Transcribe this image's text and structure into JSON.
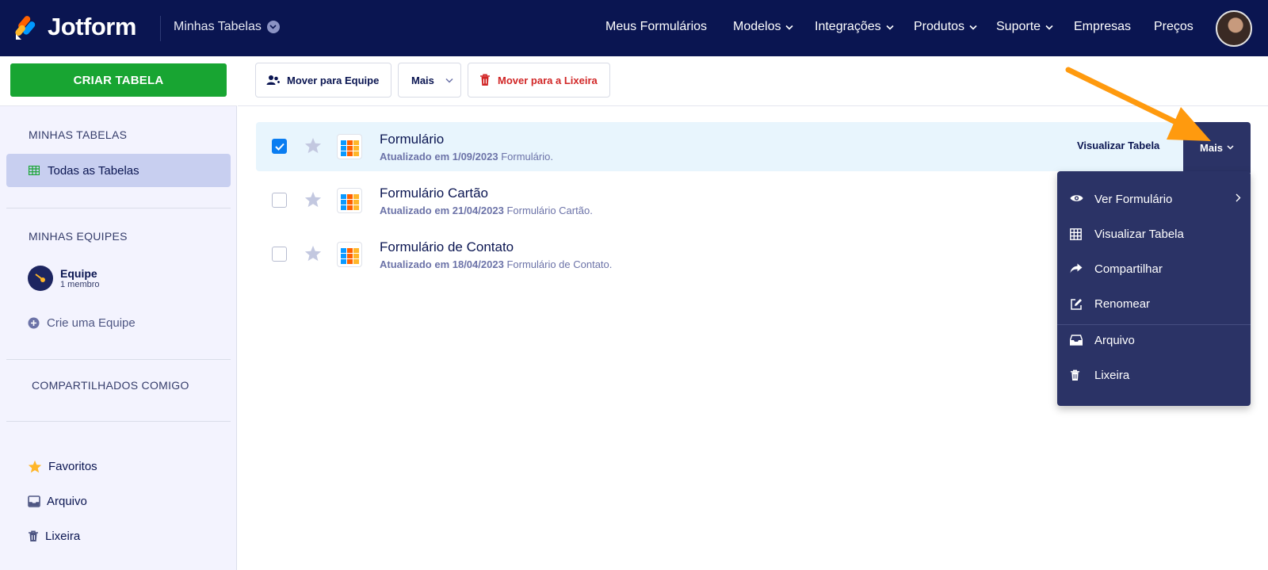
{
  "header": {
    "brand": "Jotform",
    "workspace": "Minhas Tabelas",
    "nav": [
      {
        "label": "Meus Formulários",
        "dropdown": false
      },
      {
        "label": "Modelos",
        "dropdown": true
      },
      {
        "label": "Integrações",
        "dropdown": true
      },
      {
        "label": "Produtos",
        "dropdown": true
      },
      {
        "label": "Suporte",
        "dropdown": true
      },
      {
        "label": "Empresas",
        "dropdown": false
      },
      {
        "label": "Preços",
        "dropdown": false
      }
    ]
  },
  "sidebar": {
    "create_label": "CRIAR TABELA",
    "my_tables_title": "MINHAS TABELAS",
    "all_tables_label": "Todas as Tabelas",
    "my_teams_title": "MINHAS EQUIPES",
    "team": {
      "name": "Equipe",
      "members": "1 membro"
    },
    "create_team_label": "Crie uma Equipe",
    "shared_title": "COMPARTILHADOS COMIGO",
    "favorites_label": "Favoritos",
    "archive_label": "Arquivo",
    "trash_label": "Lixeira"
  },
  "toolbar": {
    "move_team_label": "Mover para Equipe",
    "more_label": "Mais",
    "move_trash_label": "Mover para a Lixeira"
  },
  "rows": [
    {
      "title": "Formulário",
      "updated": "Atualizado em 1/09/2023",
      "source": "Formulário.",
      "selected": true
    },
    {
      "title": "Formulário Cartão",
      "updated": "Atualizado em 21/04/2023",
      "source": "Formulário Cartão.",
      "selected": false
    },
    {
      "title": "Formulário de Contato",
      "updated": "Atualizado em 18/04/2023",
      "source": "Formulário de Contato.",
      "selected": false
    }
  ],
  "row_actions": {
    "view_table_label": "Visualizar Tabela",
    "more_label": "Mais"
  },
  "menu": [
    {
      "label": "Ver Formulário",
      "icon": "eye-icon",
      "submenu": true
    },
    {
      "label": "Visualizar Tabela",
      "icon": "table-icon",
      "submenu": false
    },
    {
      "label": "Compartilhar",
      "icon": "share-icon",
      "submenu": false
    },
    {
      "label": "Renomear",
      "icon": "edit-icon",
      "submenu": false
    },
    {
      "label": "Arquivo",
      "icon": "archive-icon",
      "submenu": false
    },
    {
      "label": "Lixeira",
      "icon": "trash-icon",
      "submenu": false
    }
  ],
  "colors": {
    "navy": "#0a1551",
    "green": "#18a532",
    "menu_bg": "#2b3366",
    "selected_row": "#e8f5fd",
    "danger": "#d12626",
    "annotation": "#ff9a0e"
  }
}
